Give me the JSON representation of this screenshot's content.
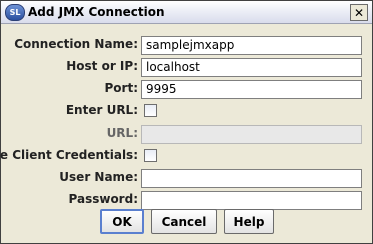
{
  "window": {
    "title": "Add JMX Connection",
    "icon_text": "SL",
    "close_glyph": "✕"
  },
  "form": {
    "connection_name": {
      "label": "Connection Name:",
      "value": "samplejmxapp"
    },
    "host": {
      "label": "Host or IP:",
      "value": "localhost"
    },
    "port": {
      "label": "Port:",
      "value": "9995"
    },
    "enter_url": {
      "label": "Enter URL:",
      "checked": false
    },
    "url": {
      "label": "URL:",
      "value": "",
      "enabled": false
    },
    "use_client_credentials": {
      "label": "Use Client Credentials:",
      "checked": false
    },
    "user_name": {
      "label": "User Name:",
      "value": ""
    },
    "password": {
      "label": "Password:",
      "value": ""
    }
  },
  "buttons": {
    "ok": "OK",
    "cancel": "Cancel",
    "help": "Help"
  }
}
